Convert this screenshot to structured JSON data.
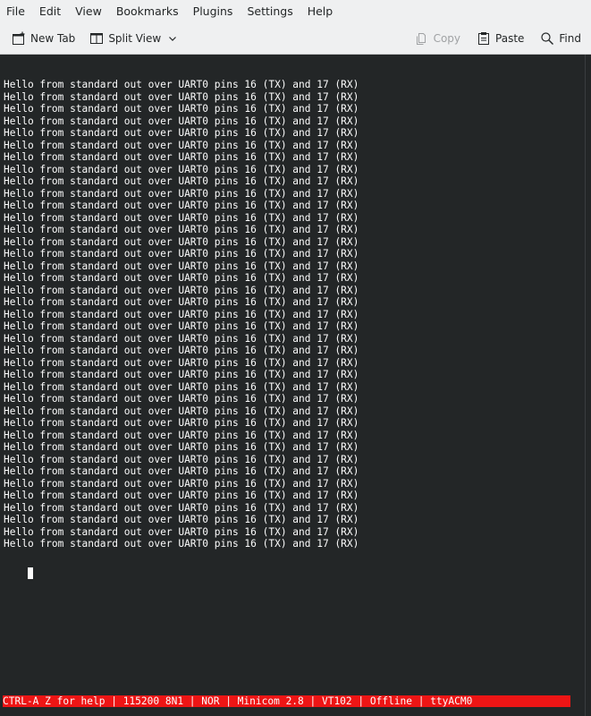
{
  "menubar": {
    "items": [
      "File",
      "Edit",
      "View",
      "Bookmarks",
      "Plugins",
      "Settings",
      "Help"
    ]
  },
  "toolbar": {
    "new_tab": {
      "label": "New Tab",
      "icon": "new-tab-icon"
    },
    "split_view": {
      "label": "Split View",
      "icon": "split-view-icon"
    },
    "copy": {
      "label": "Copy",
      "icon": "copy-icon",
      "enabled": false
    },
    "paste": {
      "label": "Paste",
      "icon": "paste-icon"
    },
    "find": {
      "label": "Find",
      "icon": "search-icon"
    }
  },
  "terminal": {
    "lines": [
      "Hello from standard out over UART0 pins 16 (TX) and 17 (RX)",
      "Hello from standard out over UART0 pins 16 (TX) and 17 (RX)",
      "Hello from standard out over UART0 pins 16 (TX) and 17 (RX)",
      "Hello from standard out over UART0 pins 16 (TX) and 17 (RX)",
      "Hello from standard out over UART0 pins 16 (TX) and 17 (RX)",
      "Hello from standard out over UART0 pins 16 (TX) and 17 (RX)",
      "Hello from standard out over UART0 pins 16 (TX) and 17 (RX)",
      "Hello from standard out over UART0 pins 16 (TX) and 17 (RX)",
      "Hello from standard out over UART0 pins 16 (TX) and 17 (RX)",
      "Hello from standard out over UART0 pins 16 (TX) and 17 (RX)",
      "Hello from standard out over UART0 pins 16 (TX) and 17 (RX)",
      "Hello from standard out over UART0 pins 16 (TX) and 17 (RX)",
      "Hello from standard out over UART0 pins 16 (TX) and 17 (RX)",
      "Hello from standard out over UART0 pins 16 (TX) and 17 (RX)",
      "Hello from standard out over UART0 pins 16 (TX) and 17 (RX)",
      "Hello from standard out over UART0 pins 16 (TX) and 17 (RX)",
      "Hello from standard out over UART0 pins 16 (TX) and 17 (RX)",
      "Hello from standard out over UART0 pins 16 (TX) and 17 (RX)",
      "Hello from standard out over UART0 pins 16 (TX) and 17 (RX)",
      "Hello from standard out over UART0 pins 16 (TX) and 17 (RX)",
      "Hello from standard out over UART0 pins 16 (TX) and 17 (RX)",
      "Hello from standard out over UART0 pins 16 (TX) and 17 (RX)",
      "Hello from standard out over UART0 pins 16 (TX) and 17 (RX)",
      "Hello from standard out over UART0 pins 16 (TX) and 17 (RX)",
      "Hello from standard out over UART0 pins 16 (TX) and 17 (RX)",
      "Hello from standard out over UART0 pins 16 (TX) and 17 (RX)",
      "Hello from standard out over UART0 pins 16 (TX) and 17 (RX)",
      "Hello from standard out over UART0 pins 16 (TX) and 17 (RX)",
      "Hello from standard out over UART0 pins 16 (TX) and 17 (RX)",
      "Hello from standard out over UART0 pins 16 (TX) and 17 (RX)",
      "Hello from standard out over UART0 pins 16 (TX) and 17 (RX)",
      "Hello from standard out over UART0 pins 16 (TX) and 17 (RX)",
      "Hello from standard out over UART0 pins 16 (TX) and 17 (RX)",
      "Hello from standard out over UART0 pins 16 (TX) and 17 (RX)",
      "Hello from standard out over UART0 pins 16 (TX) and 17 (RX)",
      "Hello from standard out over UART0 pins 16 (TX) and 17 (RX)",
      "Hello from standard out over UART0 pins 16 (TX) and 17 (RX)",
      "Hello from standard out over UART0 pins 16 (TX) and 17 (RX)",
      "Hello from standard out over UART0 pins 16 (TX) and 17 (RX)"
    ],
    "status_line": "CTRL-A Z for help | 115200 8N1 | NOR | Minicom 2.8 | VT102 | Offline | ttyACM0"
  },
  "colors": {
    "terminal_bg": "#232627",
    "terminal_fg": "#fcfcfc",
    "status_bg": "#ed1515",
    "chrome_bg": "#eff0f1"
  }
}
